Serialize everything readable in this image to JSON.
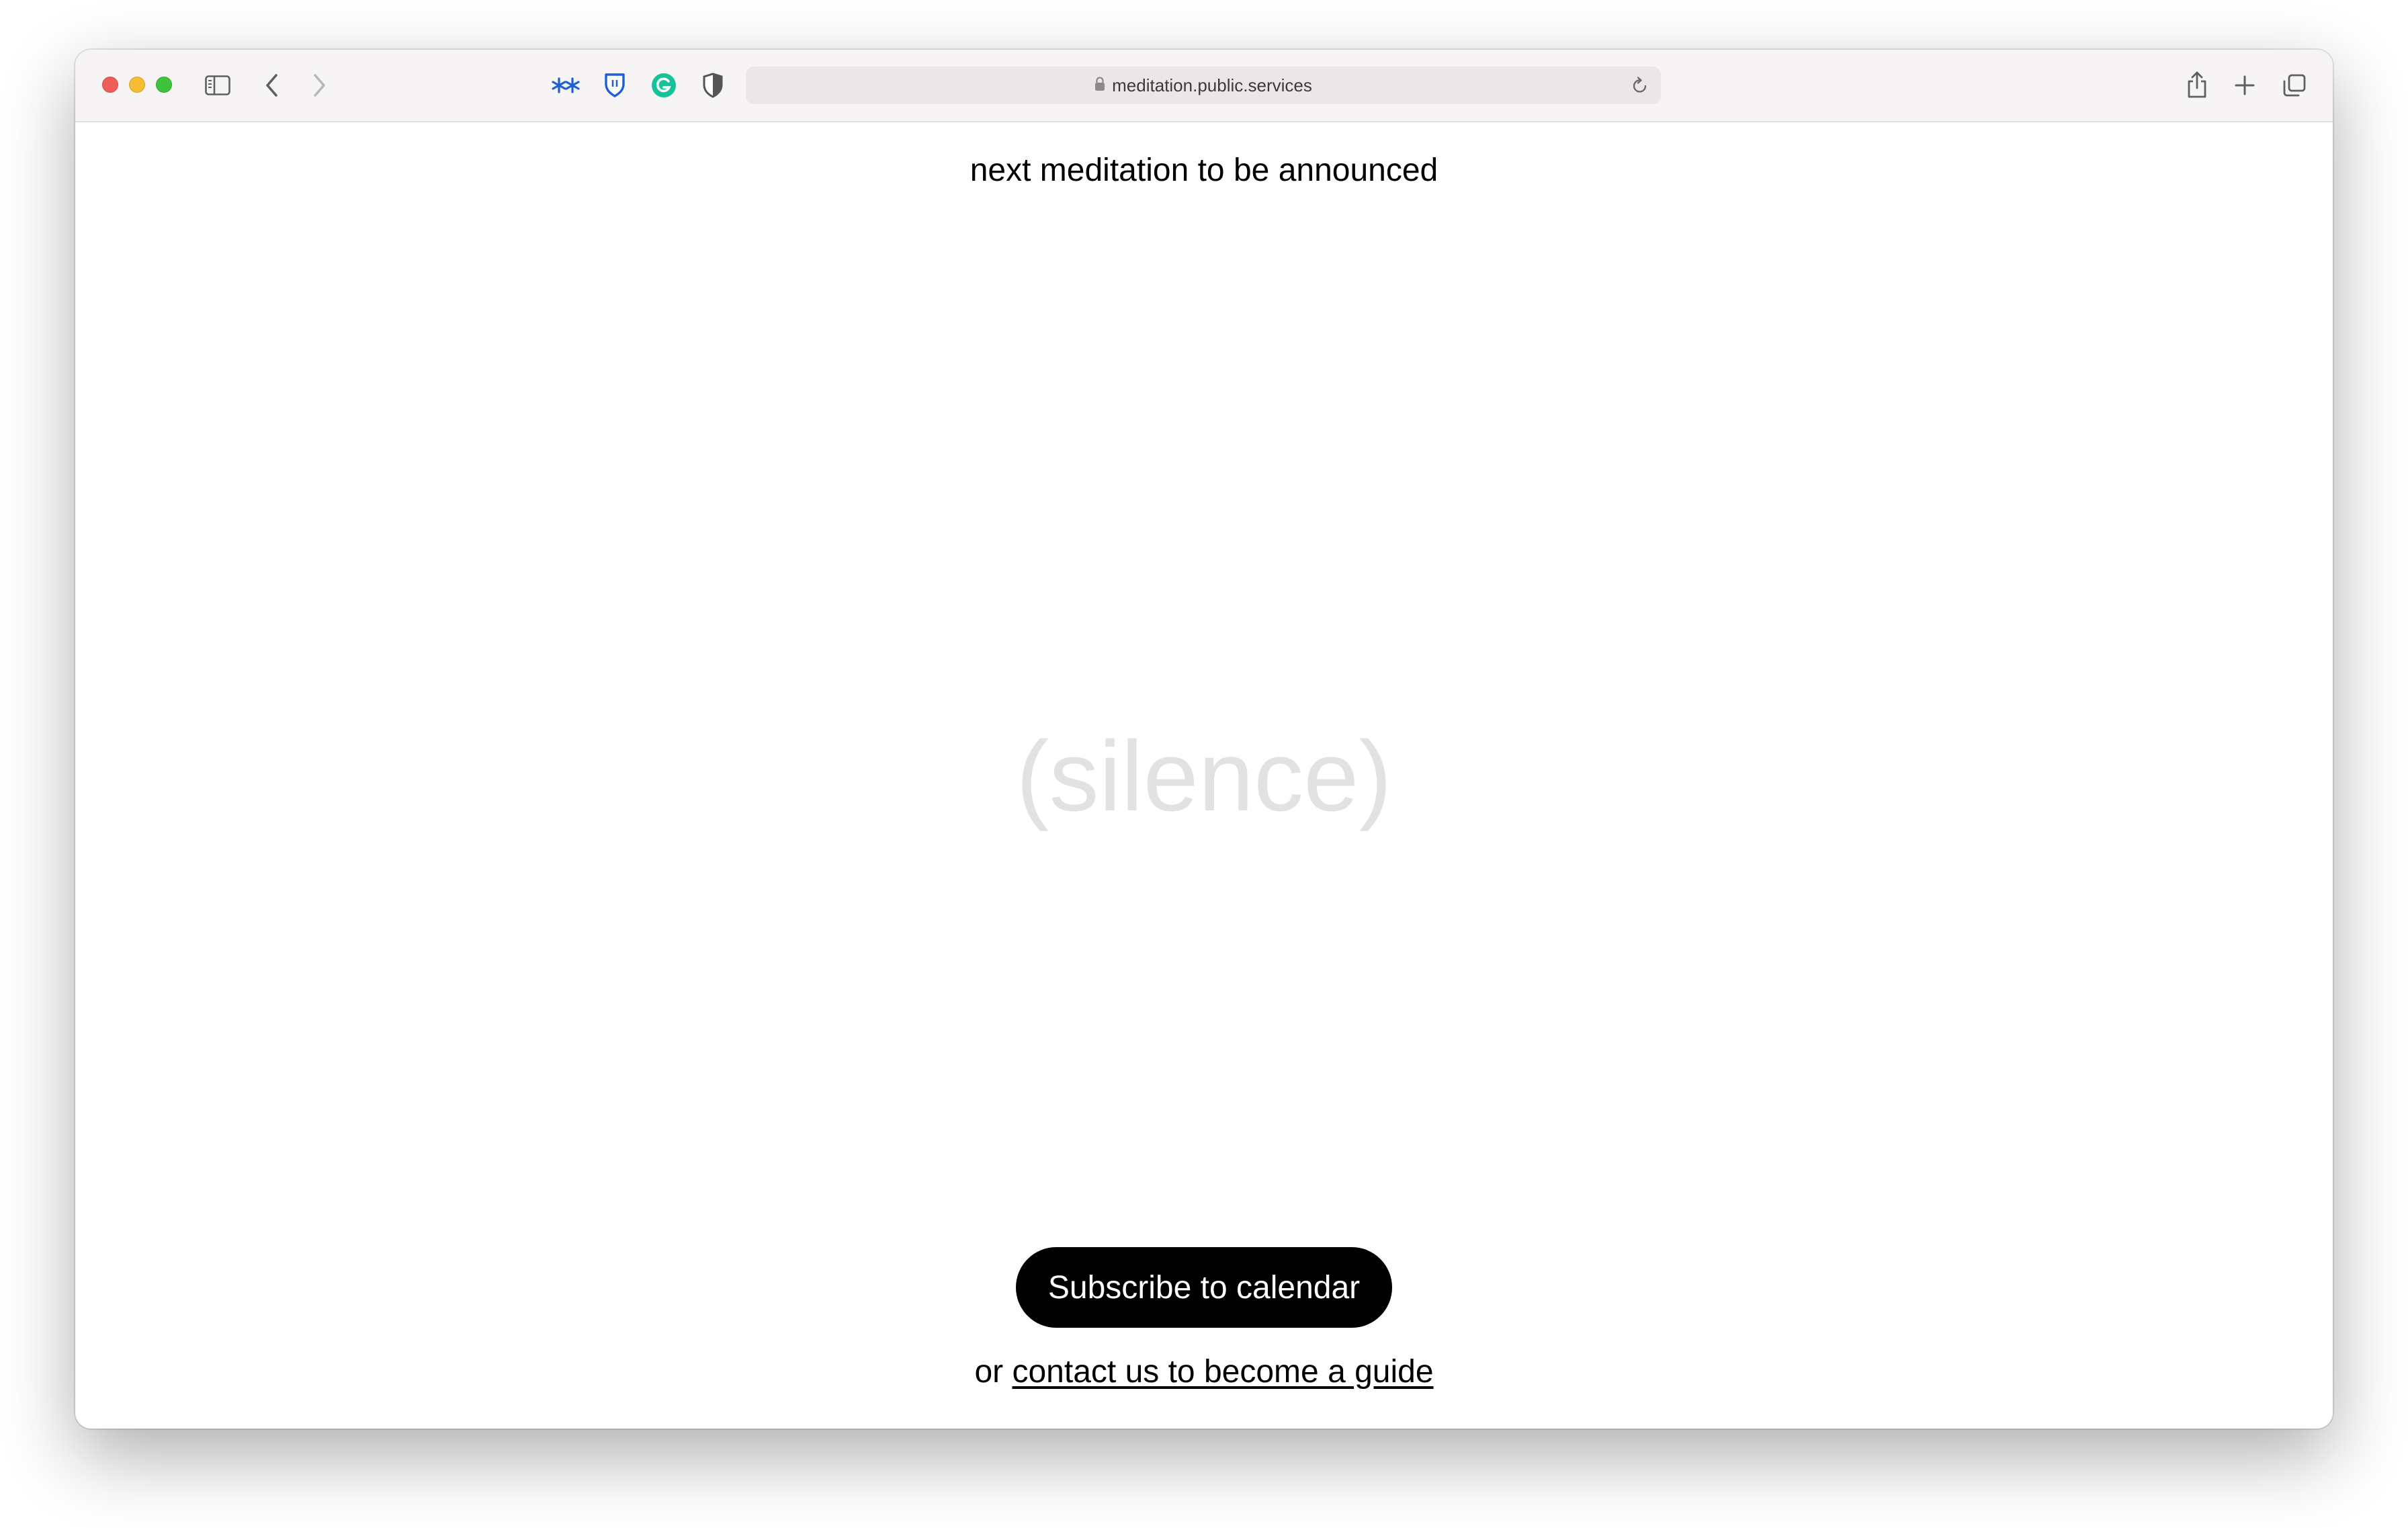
{
  "browser": {
    "url": "meditation.public.services",
    "icons": {
      "sidebar": "sidebar-icon",
      "back": "chevron-left-icon",
      "forward": "chevron-right-icon",
      "extension1": "asterisk-extension-icon",
      "extension2": "bitwarden-shield-icon",
      "extension3": "grammarly-icon",
      "extension4": "privacy-shield-icon",
      "lock": "lock-icon",
      "reload": "reload-icon",
      "share": "share-icon",
      "new_tab": "plus-icon",
      "tabs_overview": "tabs-overview-icon"
    },
    "colors": {
      "close": "#ee5e58",
      "minimize": "#f5bd34",
      "maximize": "#3fc33c",
      "grammarly": "#15c39a",
      "extension_blue": "#1f5fd6"
    }
  },
  "page": {
    "headline": "next meditation to be announced",
    "silence_text": "(silence)",
    "subscribe_label": "Subscribe to calendar",
    "footer_prefix": "or ",
    "footer_link": "contact us to become a guide"
  }
}
